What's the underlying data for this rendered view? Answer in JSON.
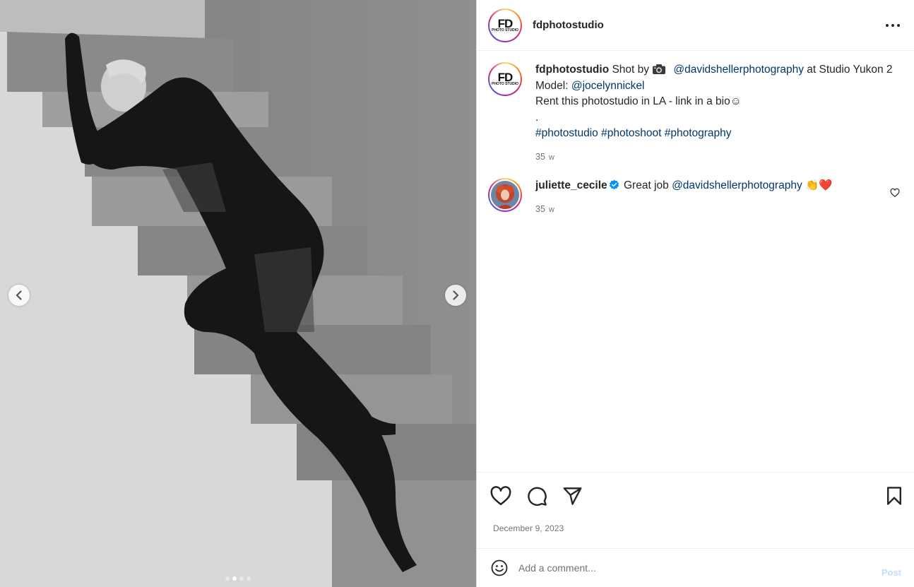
{
  "post": {
    "username": "fdphotostudio",
    "avatar_text": "FD",
    "avatar_subtext": "PHOTO STUDIO",
    "caption": {
      "pre_camera": "Shot by",
      "photographer_mention": "@davidshellerphotography",
      "location_text": "at Studio Yukon 2",
      "model_label": "Model:",
      "model_mention": "@jocelynnickel",
      "line3": "Rent this photostudio in LA - link in a bio☺",
      "line4": ".",
      "hashtags": [
        "#photostudio",
        "#photoshoot",
        "#photography"
      ],
      "age_num": "35",
      "age_unit": "w"
    },
    "carousel": {
      "total": 4,
      "active_index": 1
    }
  },
  "comments": [
    {
      "username": "juliette_cecile",
      "verified": true,
      "text": "Great job",
      "mention": "@davidshellerphotography",
      "emoji": "👏❤️",
      "age_num": "35",
      "age_unit": "w"
    }
  ],
  "footer": {
    "date": "December  9, 2023",
    "add_comment_placeholder": "Add a comment...",
    "post_label": "Post"
  },
  "icons": {
    "more": "more-horizontal-icon",
    "like": "heart-icon",
    "comment": "comment-bubble-icon",
    "share": "paper-plane-icon",
    "save": "bookmark-icon",
    "emoji": "smiley-icon",
    "prev": "chevron-left-icon",
    "next": "chevron-right-icon"
  },
  "colors": {
    "link": "#00376b",
    "verified": "#0095f6",
    "post_disabled": "#c0dffd",
    "text": "#262626",
    "muted": "#737373"
  }
}
